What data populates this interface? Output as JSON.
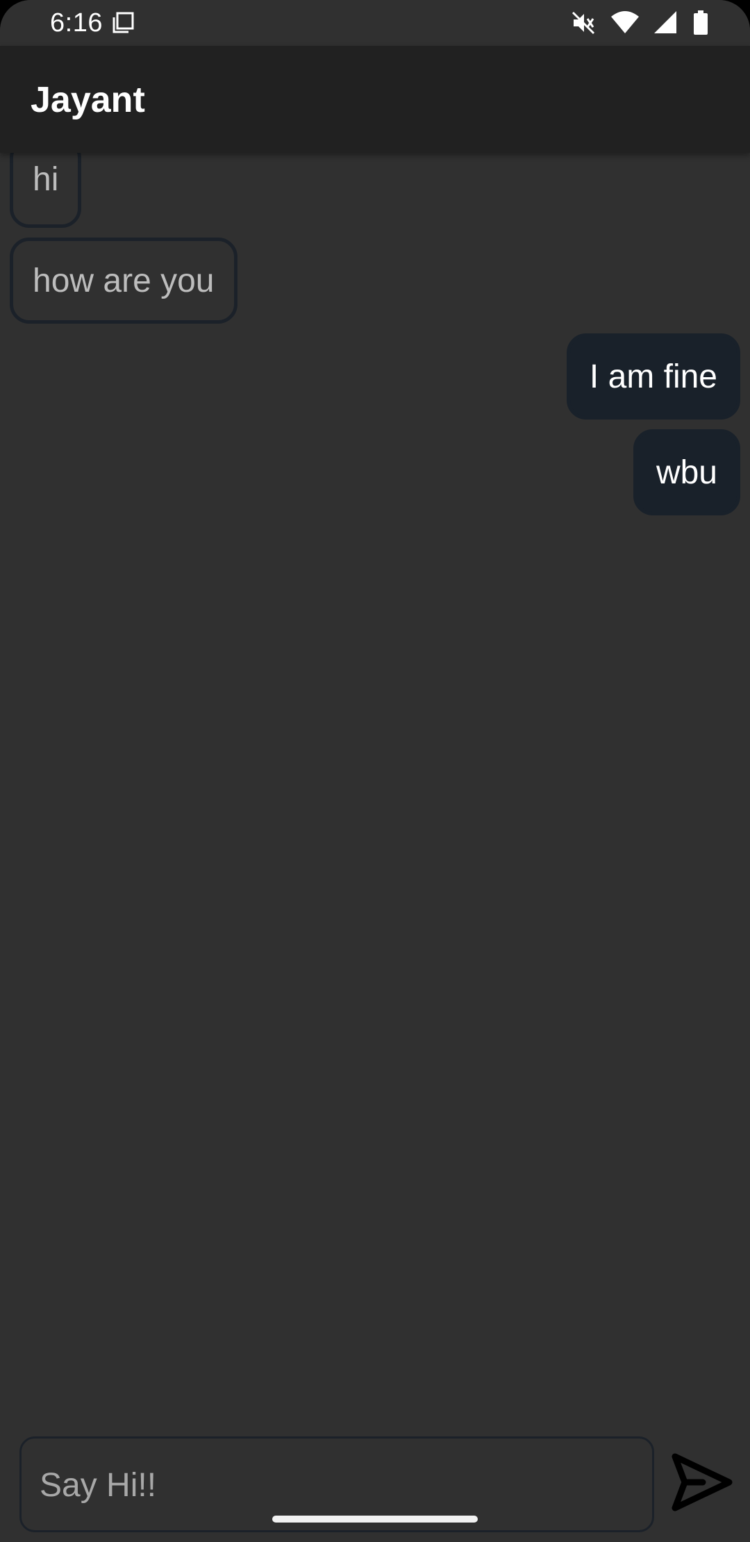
{
  "status_bar": {
    "time": "6:16",
    "icons": [
      "screenshot-icon",
      "mute-icon",
      "wifi-icon",
      "cell-signal-icon",
      "battery-icon"
    ]
  },
  "app_bar": {
    "title": "Jayant"
  },
  "messages": [
    {
      "text": "hi",
      "direction": "received"
    },
    {
      "text": "how are you",
      "direction": "received"
    },
    {
      "text": "I am fine",
      "direction": "sent"
    },
    {
      "text": "wbu",
      "direction": "sent"
    }
  ],
  "composer": {
    "placeholder": "Say Hi!!",
    "value": "",
    "send_icon": "send-icon"
  },
  "colors": {
    "background": "#303030",
    "app_bar": "#212121",
    "sent_bubble": "#19212a",
    "received_border": "#1b2129",
    "text_primary": "#ffffff",
    "text_secondary": "#bdbdbd"
  }
}
